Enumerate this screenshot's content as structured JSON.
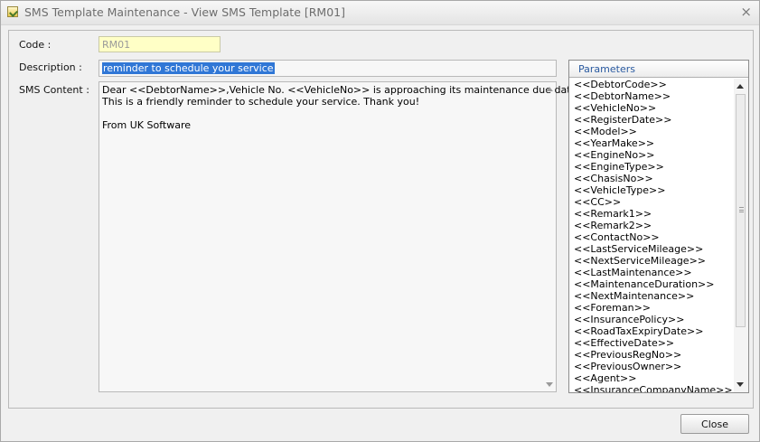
{
  "window": {
    "title": "SMS Template Maintenance - View SMS Template [RM01]",
    "close_glyph": "×"
  },
  "form": {
    "code_label": "Code :",
    "code_value": "RM01",
    "description_label": "Description :",
    "description_value": "reminder to schedule your service",
    "sms_label": "SMS Content :",
    "sms_content": "Dear <<DebtorName>>,Vehicle No. <<VehicleNo>> is approaching its maintenance due date.\nThis is a friendly reminder to schedule your service. Thank you!\n\nFrom UK Software"
  },
  "parameters": {
    "title": "Parameters",
    "items": [
      "<<DebtorCode>>",
      "<<DebtorName>>",
      "<<VehicleNo>>",
      "<<RegisterDate>>",
      "<<Model>>",
      "<<YearMake>>",
      "<<EngineNo>>",
      "<<EngineType>>",
      "<<ChasisNo>>",
      "<<VehicleType>>",
      "<<CC>>",
      "<<Remark1>>",
      "<<Remark2>>",
      "<<ContactNo>>",
      "<<LastServiceMileage>>",
      "<<NextServiceMileage>>",
      "<<LastMaintenance>>",
      "<<MaintenanceDuration>>",
      "<<NextMaintenance>>",
      "<<Foreman>>",
      "<<InsurancePolicy>>",
      "<<RoadTaxExpiryDate>>",
      "<<EffectiveDate>>",
      "<<PreviousRegNo>>",
      "<<PreviousOwner>>",
      "<<Agent>>",
      "<<InsuranceCompanyName>>"
    ]
  },
  "buttons": {
    "close_label": "Close"
  },
  "icons": {
    "window_icon": "template-icon",
    "close": "close-icon",
    "scroll_up": "chevron-up-icon",
    "scroll_down": "chevron-down-icon"
  },
  "colors": {
    "selection": "#3077d6",
    "code_field_bg": "#ffffc6",
    "parameters_title": "#2a5aa0"
  }
}
